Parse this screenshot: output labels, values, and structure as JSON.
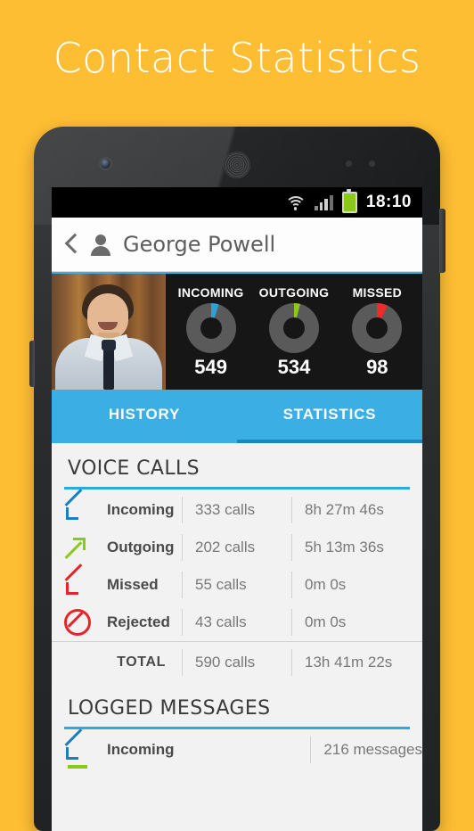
{
  "promo": {
    "title": "Contact Statistics",
    "background_color": "#FEBE34"
  },
  "statusbar": {
    "time": "18:10",
    "icons": [
      "wifi-icon",
      "signal-icon",
      "battery-icon"
    ]
  },
  "actionbar": {
    "back_icon": "back-chevron-icon",
    "contact_icon": "person-icon",
    "contact_name": "George Powell"
  },
  "summary": {
    "photo_alt": "contact-photo",
    "donuts": [
      {
        "label": "INCOMING",
        "value": "549",
        "color": "#2F9FD8",
        "percent": 5
      },
      {
        "label": "OUTGOING",
        "value": "534",
        "color": "#8BC919",
        "percent": 4
      },
      {
        "label": "MISSED",
        "value": "98",
        "color": "#EE2B2B",
        "percent": 7
      }
    ],
    "track_color": "#5A5A5A",
    "background_color": "#161616"
  },
  "tabs": [
    {
      "label": "HISTORY",
      "active": false
    },
    {
      "label": "STATISTICS",
      "active": true
    }
  ],
  "tab_bar_color": "#3BAEE3",
  "tab_indicator_color": "#1B87BD",
  "sections": [
    {
      "title": "VOICE CALLS",
      "rule_color": "#2EA8E0",
      "rows": [
        {
          "icon": "incoming-arrow-icon",
          "icon_color": "#1A7FC1",
          "label": "Incoming",
          "count": "333 calls",
          "duration": "8h 27m 46s"
        },
        {
          "icon": "outgoing-arrow-icon",
          "icon_color": "#8BC919",
          "label": "Outgoing",
          "count": "202 calls",
          "duration": "5h 13m 36s"
        },
        {
          "icon": "missed-arrow-icon",
          "icon_color": "#E8242A",
          "label": "Missed",
          "count": "55 calls",
          "duration": "0m 0s"
        },
        {
          "icon": "rejected-ban-icon",
          "icon_color": "#E8242A",
          "label": "Rejected",
          "count": "43 calls",
          "duration": "0m 0s"
        }
      ],
      "total": {
        "label": "TOTAL",
        "count": "590 calls",
        "duration": "13h 41m 22s"
      }
    },
    {
      "title": "LOGGED MESSAGES",
      "rule_color": "#2EA8E0",
      "rows": [
        {
          "icon": "incoming-arrow-icon",
          "icon_color": "#1A7FC1",
          "label": "Incoming",
          "count": "216 messages",
          "duration": ""
        }
      ]
    }
  ]
}
